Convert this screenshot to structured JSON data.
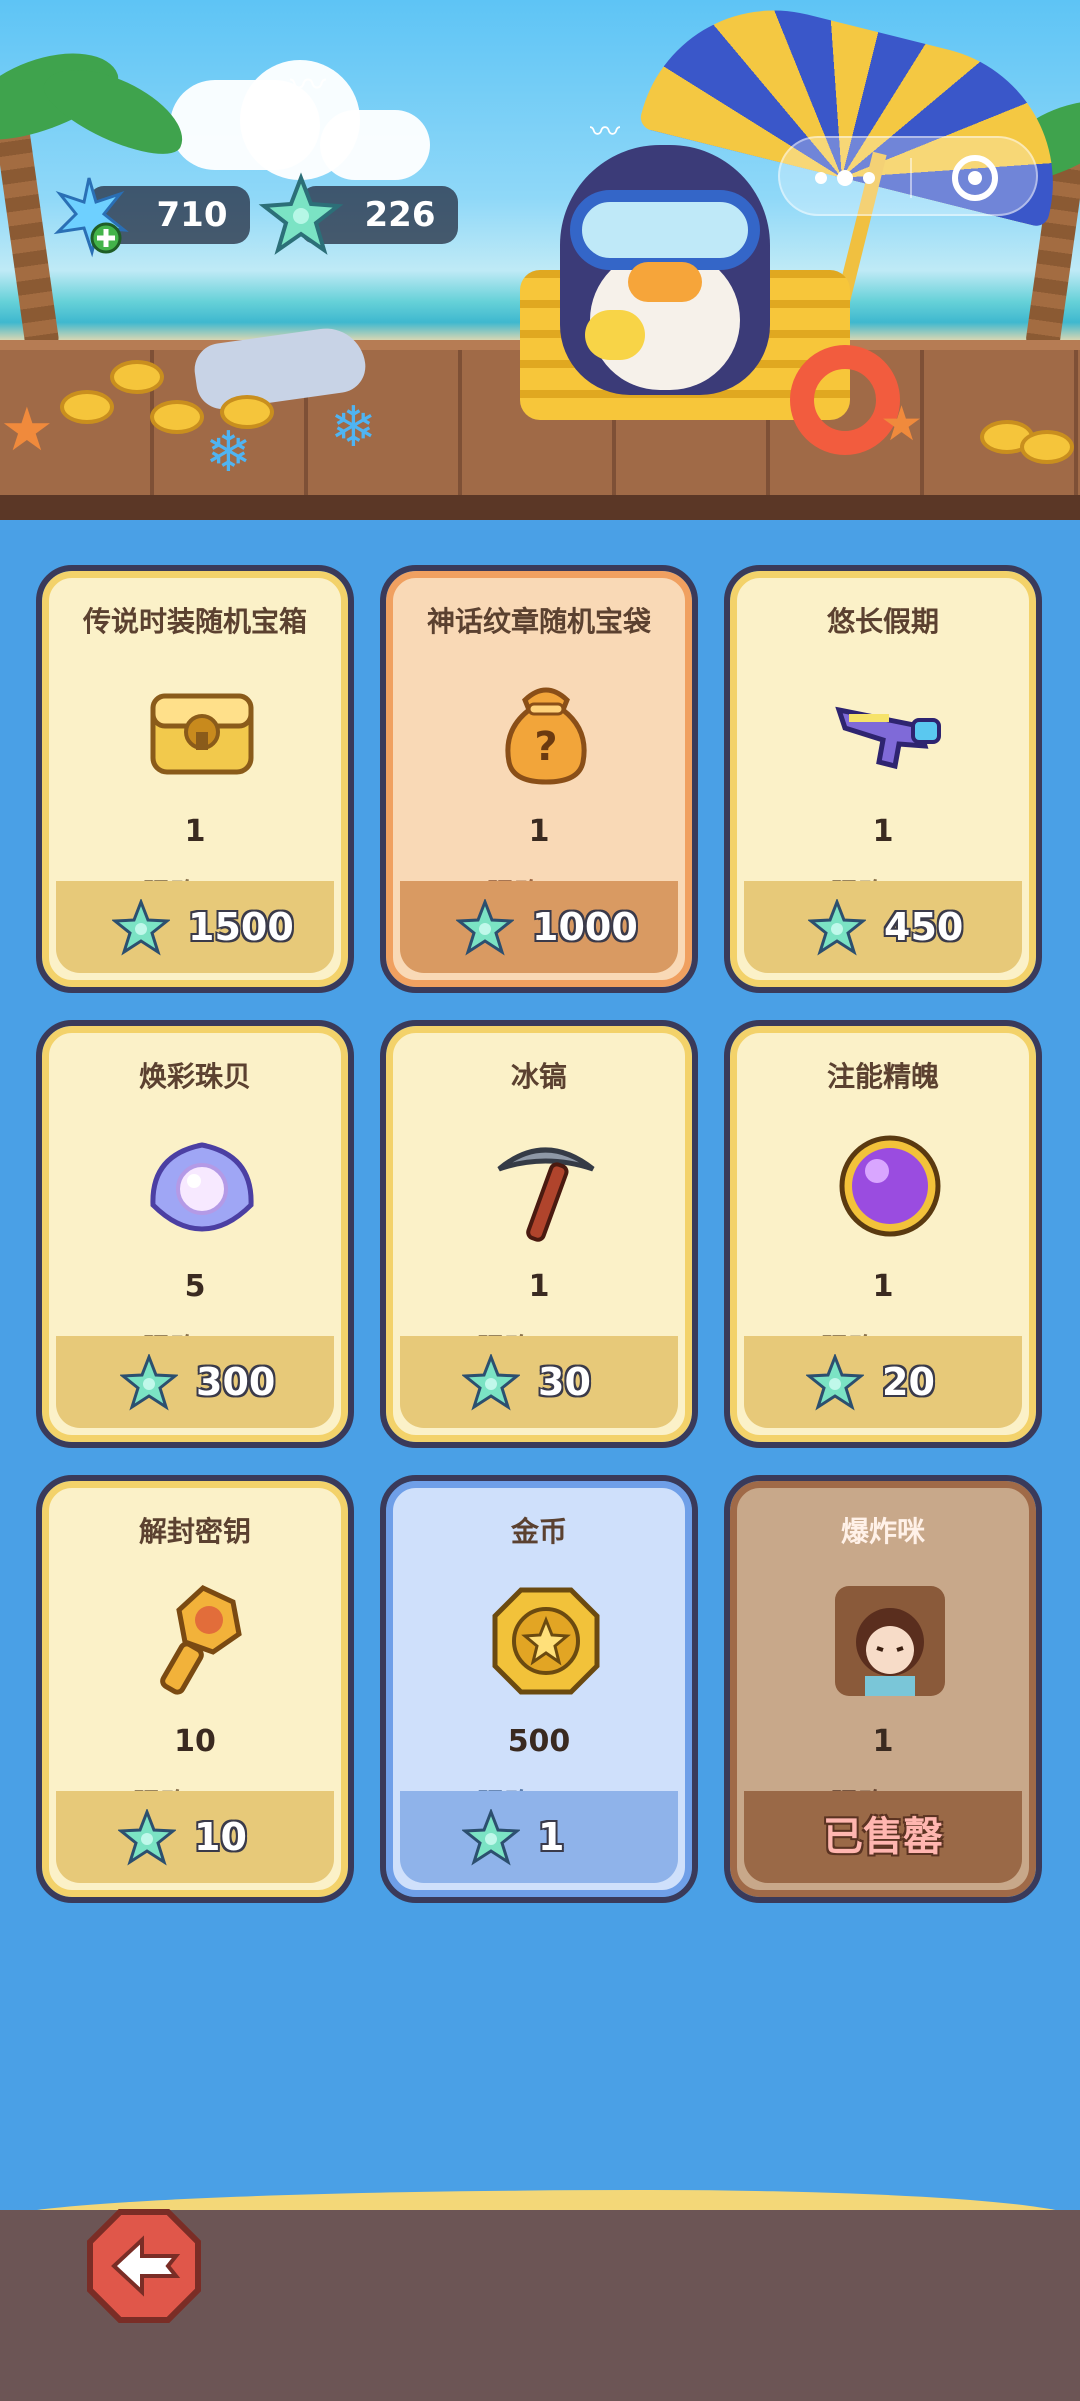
{
  "currency": {
    "ice_crystal": {
      "value": "710",
      "icon": "ice-crystal-plus-icon"
    },
    "star_shell": {
      "value": "226",
      "icon": "starfish-icon"
    }
  },
  "capsule": {
    "more_icon": "more-dots-icon",
    "close_icon": "target-close-icon"
  },
  "shop_items": [
    {
      "name": "传说时装随机宝箱",
      "qty": "1",
      "limit": "限购0/2",
      "price": "1500",
      "theme": "yellow",
      "icon": "chest-icon"
    },
    {
      "name": "神话纹章随机宝袋",
      "qty": "1",
      "limit": "限购0/1",
      "price": "1000",
      "theme": "orange",
      "icon": "mystery-bag-icon"
    },
    {
      "name": "悠长假期",
      "qty": "1",
      "limit": "限购0/8",
      "price": "450",
      "theme": "yellow",
      "icon": "water-gun-icon"
    },
    {
      "name": "焕彩珠贝",
      "qty": "5",
      "limit": "限购0/4",
      "price": "300",
      "theme": "yellow",
      "icon": "pearl-shell-icon"
    },
    {
      "name": "冰镐",
      "qty": "1",
      "limit": "限购0/10",
      "price": "30",
      "theme": "yellow",
      "icon": "pickaxe-icon"
    },
    {
      "name": "注能精魄",
      "qty": "1",
      "limit": "限购0/20",
      "price": "20",
      "theme": "yellow",
      "icon": "purple-orb-icon"
    },
    {
      "name": "解封密钥",
      "qty": "10",
      "limit": "限购0/99",
      "price": "10",
      "theme": "yellow",
      "icon": "key-icon"
    },
    {
      "name": "金币",
      "qty": "500",
      "limit": "限购0/99",
      "price": "1",
      "theme": "blue",
      "icon": "gold-coin-icon"
    },
    {
      "name": "爆炸咪",
      "qty": "1",
      "limit": "限购1/1",
      "price": "",
      "sold_out": "已售罄",
      "theme": "brown",
      "icon": "character-portrait-icon"
    }
  ],
  "navigation": {
    "back_icon": "back-arrow-icon"
  }
}
